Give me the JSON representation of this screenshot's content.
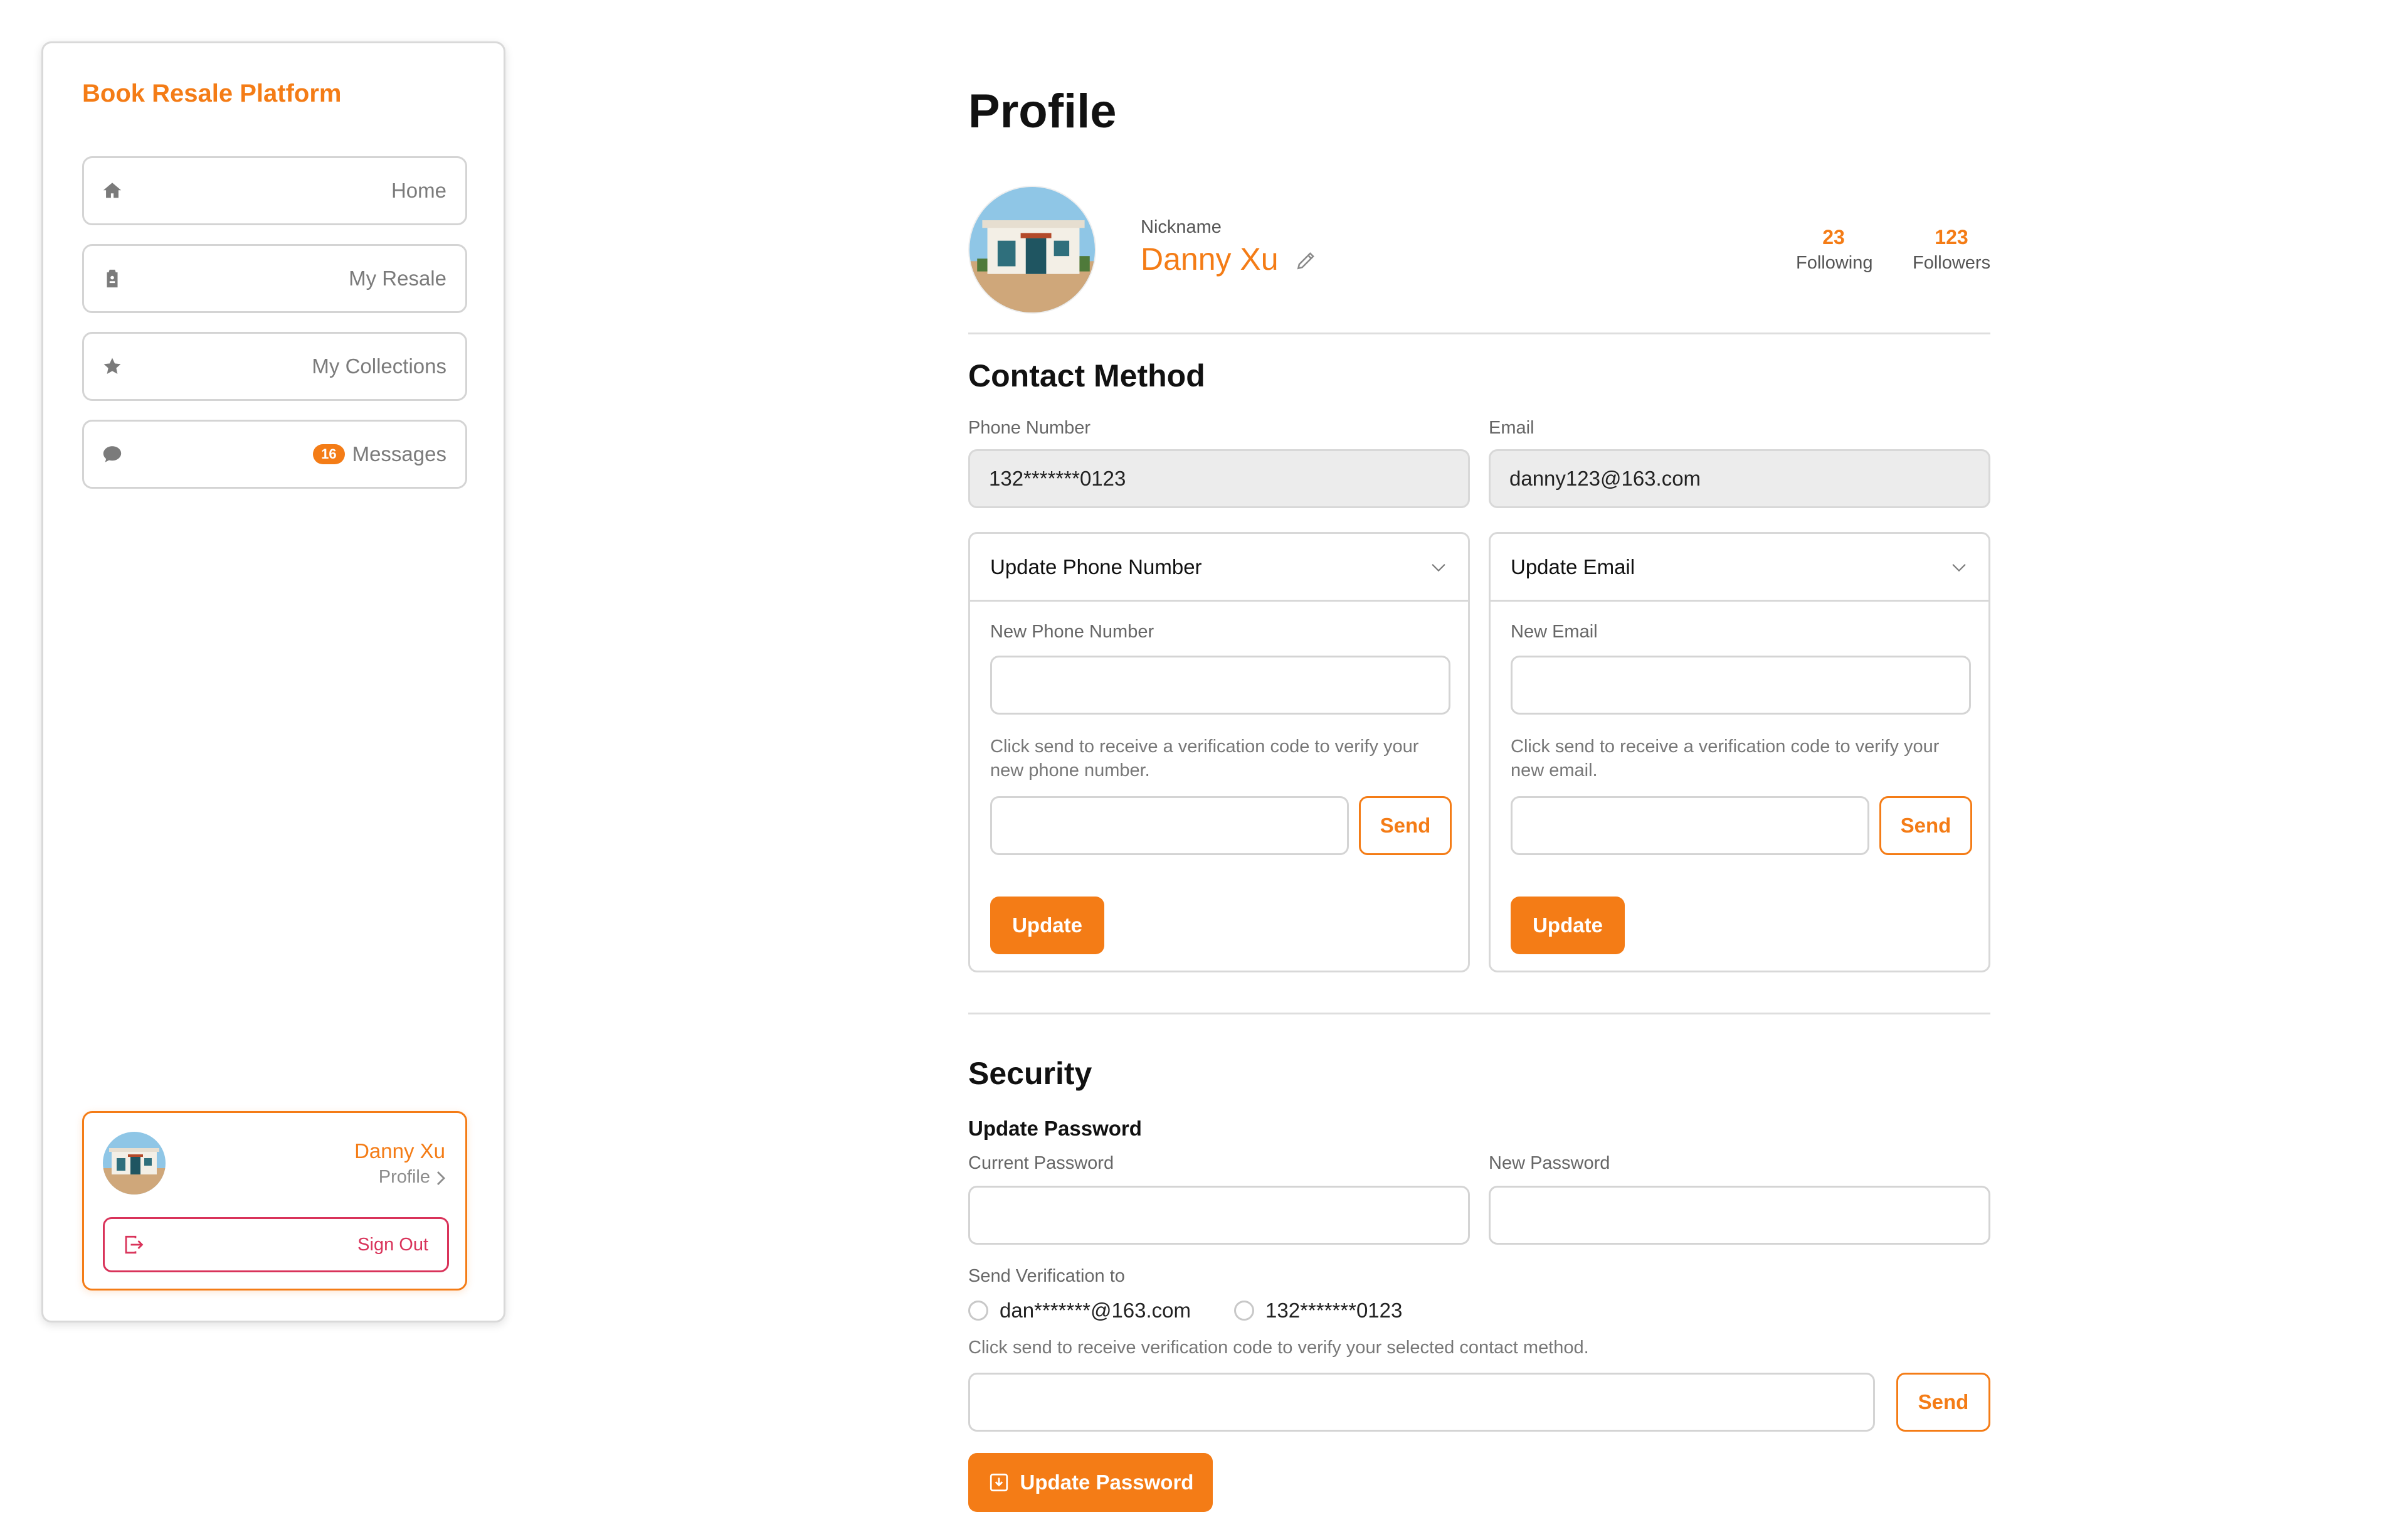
{
  "sidebar": {
    "brand": "Book Resale Platform",
    "items": [
      {
        "label": "Home",
        "icon": "home-icon"
      },
      {
        "label": "My Resale",
        "icon": "tag-icon"
      },
      {
        "label": "My Collections",
        "icon": "star-icon"
      },
      {
        "label": "Messages",
        "icon": "chat-icon",
        "badge": "16"
      }
    ],
    "user": {
      "name": "Danny Xu",
      "profile_link": "Profile",
      "sign_out": "Sign Out"
    }
  },
  "profile": {
    "title": "Profile",
    "nickname_label": "Nickname",
    "nickname": "Danny Xu",
    "following_count": "23",
    "following_label": "Following",
    "followers_count": "123",
    "followers_label": "Followers"
  },
  "contact": {
    "title": "Contact Method",
    "phone_label": "Phone Number",
    "phone_value": "132*******0123",
    "email_label": "Email",
    "email_value": "danny123@163.com",
    "phone_update": {
      "header": "Update Phone Number",
      "field_label": "New Phone Number",
      "hint": "Click send to receive a verification code to verify your new phone number.",
      "send": "Send",
      "update": "Update"
    },
    "email_update": {
      "header": "Update Email",
      "field_label": "New Email",
      "hint": "Click send to receive a verification code to verify your new email.",
      "send": "Send",
      "update": "Update"
    }
  },
  "security": {
    "title": "Security",
    "subtitle": "Update Password",
    "current_password_label": "Current Password",
    "new_password_label": "New Password",
    "send_to_label": "Send Verification to",
    "options": [
      "dan*******@163.com",
      "132*******0123"
    ],
    "hint": "Click send to receive verification code to verify your selected contact method.",
    "send": "Send",
    "update_password": "Update Password"
  },
  "colors": {
    "accent": "#f47c16",
    "danger": "#d9335a",
    "border": "#d4d4d4"
  }
}
